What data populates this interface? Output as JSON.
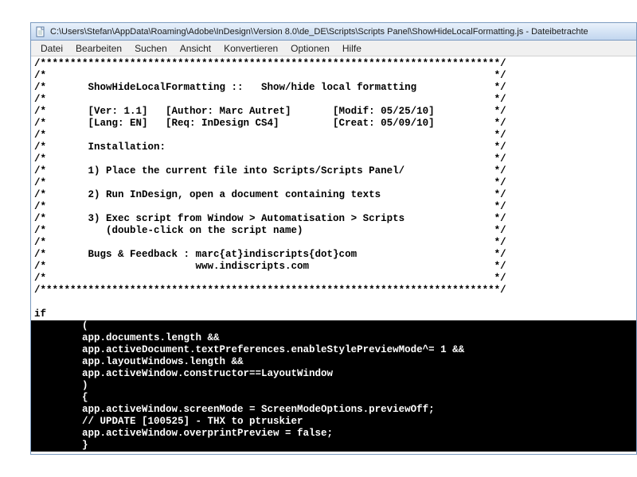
{
  "window": {
    "path": "C:\\Users\\Stefan\\AppData\\Roaming\\Adobe\\InDesign\\Version 8.0\\de_DE\\Scripts\\Scripts Panel\\ShowHideLocalFormatting.js - Dateibetrachte"
  },
  "menu": {
    "datei": "Datei",
    "bearbeiten": "Bearbeiten",
    "suchen": "Suchen",
    "ansicht": "Ansicht",
    "konvertieren": "Konvertieren",
    "optionen": "Optionen",
    "hilfe": "Hilfe"
  },
  "code": {
    "l01": "/*****************************************************************************/",
    "l02": "/*                                                                           */",
    "l03": "/*       ShowHideLocalFormatting ::   Show/hide local formatting             */",
    "l04": "/*                                                                           */",
    "l05": "/*       [Ver: 1.1]   [Author: Marc Autret]       [Modif: 05/25/10]          */",
    "l06": "/*       [Lang: EN]   [Req: InDesign CS4]         [Creat: 05/09/10]          */",
    "l07": "/*                                                                           */",
    "l08": "/*       Installation:                                                       */",
    "l09": "/*                                                                           */",
    "l10": "/*       1) Place the current file into Scripts/Scripts Panel/               */",
    "l11": "/*                                                                           */",
    "l12": "/*       2) Run InDesign, open a document containing texts                   */",
    "l13": "/*                                                                           */",
    "l14": "/*       3) Exec script from Window > Automatisation > Scripts               */",
    "l15": "/*          (double-click on the script name)                                */",
    "l16": "/*                                                                           */",
    "l17": "/*       Bugs & Feedback : marc{at}indiscripts{dot}com                       */",
    "l18": "/*                         www.indiscripts.com                               */",
    "l19": "/*                                                                           */",
    "l20": "/*****************************************************************************/",
    "l21": "",
    "s_if": "if",
    "s01": "        (",
    "s02": "        app.documents.length &&",
    "s03": "        app.activeDocument.textPreferences.enableStylePreviewMode^= 1 &&",
    "s04": "        app.layoutWindows.length &&",
    "s05": "        app.activeWindow.constructor==LayoutWindow",
    "s06": "        )",
    "s07": "        {",
    "s08": "        app.activeWindow.screenMode = ScreenModeOptions.previewOff;",
    "s09": "        // UPDATE [100525] - THX to ptruskier",
    "s10": "        app.activeWindow.overprintPreview = false;",
    "s11": "        }"
  }
}
